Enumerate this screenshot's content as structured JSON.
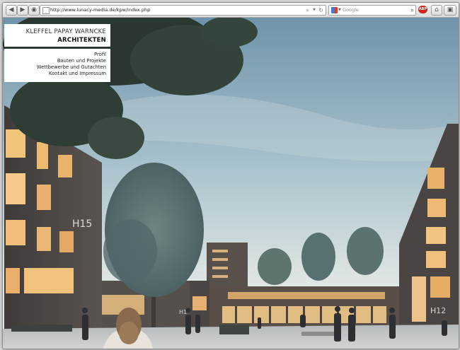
{
  "browser": {
    "url": "http://www.lunacy-media.de/kpw/index.php",
    "search_placeholder": "Google",
    "addon_label": "ABP"
  },
  "site": {
    "brand_line1": "KLEFFEL PAPAY WARNCKE",
    "brand_line2": "ARCHITEKTEN",
    "nav": [
      {
        "label": "Profil"
      },
      {
        "label": "Bauten und Projekte"
      },
      {
        "label": "Wettbewerbe und Gutachten"
      },
      {
        "label": "Kontakt und Impressum"
      }
    ]
  },
  "scene": {
    "building_labels": [
      "H15",
      "H1",
      "H12"
    ]
  },
  "colors": {
    "sky_top": "#6f93aa",
    "sky_bottom": "#dfe6e4",
    "brick": "#4e4a47",
    "window_glow": "#f2c27a",
    "plaza": "#c8cbc9"
  }
}
